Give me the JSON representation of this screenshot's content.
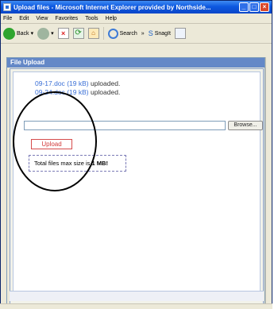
{
  "window": {
    "title": "Upload files - Microsoft Internet Explorer provided by Northside..."
  },
  "menu": [
    "File",
    "Edit",
    "View",
    "Favorites",
    "Tools",
    "Help"
  ],
  "toolbar": {
    "back": "Back",
    "search": "Search",
    "snagit": "SnagIt"
  },
  "panel": {
    "title": "File Upload"
  },
  "uploaded": [
    {
      "name": "09-17.doc",
      "size": "(19 kB)",
      "status": "uploaded."
    },
    {
      "name": "09-24.doc",
      "size": "(19 kB)",
      "status": "uploaded."
    }
  ],
  "form": {
    "browse_label": "Browse...",
    "upload_label": "Upload",
    "max_prefix": "Total files max size is",
    "max_value": "1 MB!"
  }
}
